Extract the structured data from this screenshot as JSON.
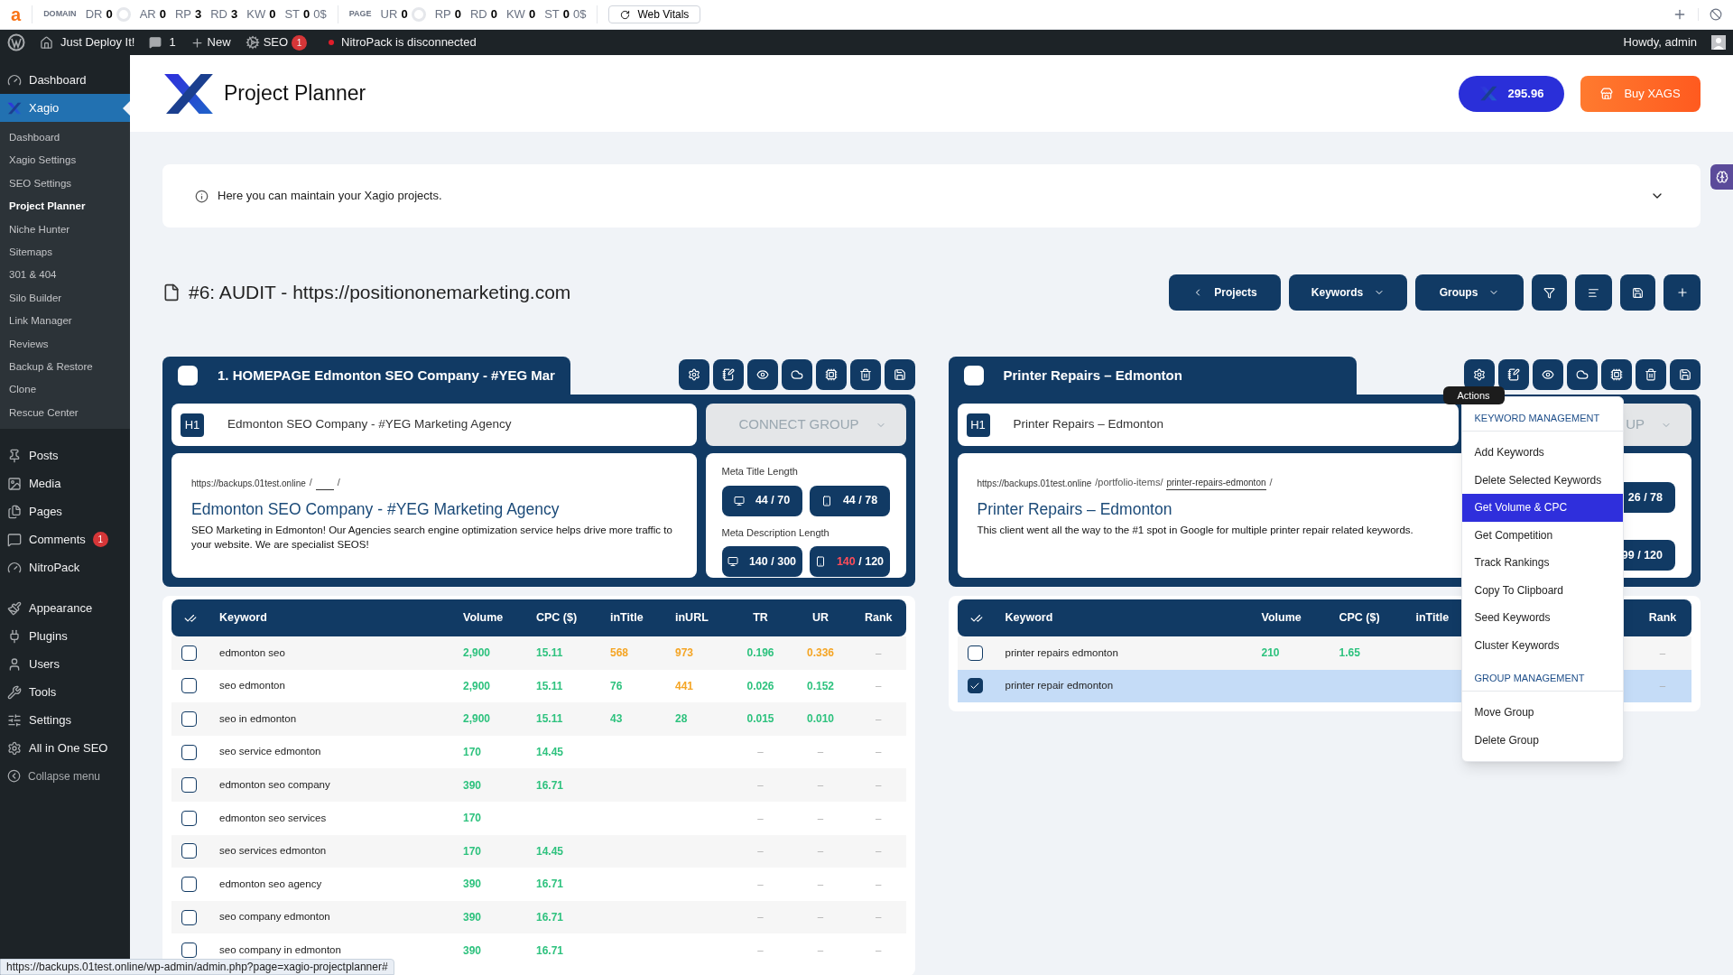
{
  "seo_toolbar": {
    "logo": "a",
    "groups": [
      {
        "label": "DOMAIN",
        "metrics": [
          {
            "name": "DR",
            "value": "0",
            "kind": "ring"
          },
          {
            "name": "AR",
            "value": "0",
            "kind": "plain"
          },
          {
            "name": "RP",
            "value": "3",
            "kind": "plain"
          },
          {
            "name": "RD",
            "value": "3",
            "kind": "plain"
          },
          {
            "name": "KW",
            "value": "0",
            "kind": "plain"
          },
          {
            "name": "ST",
            "value": "0",
            "kind": "plain",
            "extra": "0$"
          }
        ]
      },
      {
        "label": "PAGE",
        "metrics": [
          {
            "name": "UR",
            "value": "0",
            "kind": "ring"
          },
          {
            "name": "RP",
            "value": "0",
            "kind": "plain"
          },
          {
            "name": "RD",
            "value": "0",
            "kind": "plain"
          },
          {
            "name": "KW",
            "value": "0",
            "kind": "plain"
          },
          {
            "name": "ST",
            "value": "0",
            "kind": "plain",
            "extra": "0$"
          }
        ]
      }
    ],
    "button": "Web Vitals"
  },
  "admin_bar": {
    "site": "Just Deploy It!",
    "comments": "1",
    "new": "New",
    "seo": "SEO",
    "seo_badge": "1",
    "notice": "NitroPack is disconnected",
    "greeting": "Howdy, admin"
  },
  "sidebar": {
    "sections": [
      [
        {
          "label": "Dashboard",
          "selected": false
        },
        {
          "label": "Xagio",
          "selected": true,
          "children": [
            {
              "label": "Dashboard",
              "selected": false
            },
            {
              "label": "Xagio Settings",
              "selected": false
            },
            {
              "label": "SEO Settings",
              "selected": false
            },
            {
              "label": "Project Planner",
              "selected": true
            },
            {
              "label": "Niche Hunter",
              "selected": false
            },
            {
              "label": "Sitemaps",
              "selected": false
            },
            {
              "label": "301 & 404",
              "selected": false
            },
            {
              "label": "Silo Builder",
              "selected": false
            },
            {
              "label": "Link Manager",
              "selected": false
            },
            {
              "label": "Reviews",
              "selected": false
            },
            {
              "label": "Backup & Restore",
              "selected": false
            },
            {
              "label": "Clone",
              "selected": false
            },
            {
              "label": "Rescue Center",
              "selected": false
            }
          ]
        }
      ],
      [
        {
          "label": "Posts",
          "selected": false
        },
        {
          "label": "Media",
          "selected": false
        },
        {
          "label": "Pages",
          "selected": false
        },
        {
          "label": "Comments",
          "selected": false,
          "badge": "1"
        },
        {
          "label": "NitroPack",
          "selected": false
        }
      ],
      [
        {
          "label": "Appearance",
          "selected": false
        },
        {
          "label": "Plugins",
          "selected": false
        },
        {
          "label": "Users",
          "selected": false
        },
        {
          "label": "Tools",
          "selected": false
        },
        {
          "label": "Settings",
          "selected": false
        },
        {
          "label": "All in One SEO",
          "selected": false
        }
      ]
    ],
    "collapse": "Collapse menu"
  },
  "header": {
    "title": "Project Planner",
    "credits": "295.96",
    "buy": "Buy XAGS"
  },
  "info": "Here you can maintain your Xagio projects.",
  "project": {
    "title": "#6: AUDIT - https://positiononemarketing.com",
    "buttons": [
      "Projects",
      "Keywords",
      "Groups"
    ]
  },
  "groups": [
    {
      "selected": false,
      "name": "1. HOMEPAGE Edmonton SEO Company - #YEG Mar",
      "tag": "H1",
      "h1": "Edmonton SEO Company - #YEG Marketing Agency",
      "connect_group": "CONNECT GROUP",
      "serp": {
        "url": "https://backups.01test.online",
        "path": "/",
        "end": "/",
        "title": "Edmonton SEO Company - #YEG Marketing Agency",
        "description": "SEO Marketing in Edmonton! Our Agencies search engine optimization service helps drive more traffic to your website. We are specialist SEOS!"
      },
      "meta": [
        {
          "label": "Meta Title Length",
          "badges": [
            {
              "kind": "desktop",
              "count": "44",
              "limit": "/ 70",
              "over": false
            },
            {
              "kind": "mobile",
              "count": "44",
              "limit": "/ 78",
              "over": false
            }
          ]
        },
        {
          "label": "Meta Description Length",
          "badges": [
            {
              "kind": "desktop",
              "count": "140",
              "limit": "/ 300",
              "over": false
            },
            {
              "kind": "mobile",
              "count": "140",
              "limit": "/ 120",
              "over": true
            }
          ]
        }
      ],
      "table": {
        "columns": [
          "Keyword",
          "Volume",
          "CPC ($)",
          "inTitle",
          "inURL",
          "TR",
          "UR",
          "Rank"
        ],
        "rows": [
          {
            "selected": false,
            "cells": [
              "edmonton seo",
              {
                "value": "2,900",
                "color": "#2ec27e"
              },
              {
                "value": "15.11",
                "color": "#2ec27e"
              },
              {
                "value": "568",
                "color": "#f5a524"
              },
              {
                "value": "973",
                "color": "#f5a524"
              },
              {
                "value": "0.196",
                "color": "#2ec27e"
              },
              {
                "value": "0.336",
                "color": "#f5a524"
              },
              "–"
            ]
          },
          {
            "selected": false,
            "cells": [
              "seo edmonton",
              {
                "value": "2,900",
                "color": "#2ec27e"
              },
              {
                "value": "15.11",
                "color": "#2ec27e"
              },
              {
                "value": "76",
                "color": "#2ec27e"
              },
              {
                "value": "441",
                "color": "#f5a524"
              },
              {
                "value": "0.026",
                "color": "#2ec27e"
              },
              {
                "value": "0.152",
                "color": "#2ec27e"
              },
              "–"
            ]
          },
          {
            "selected": false,
            "cells": [
              "seo in edmonton",
              {
                "value": "2,900",
                "color": "#2ec27e"
              },
              {
                "value": "15.11",
                "color": "#2ec27e"
              },
              {
                "value": "43",
                "color": "#2ec27e"
              },
              {
                "value": "28",
                "color": "#2ec27e"
              },
              {
                "value": "0.015",
                "color": "#2ec27e"
              },
              {
                "value": "0.010",
                "color": "#2ec27e"
              },
              "–"
            ]
          },
          {
            "selected": false,
            "cells": [
              "seo service edmonton",
              {
                "value": "170",
                "color": "#2ec27e"
              },
              {
                "value": "14.45",
                "color": "#2ec27e"
              },
              null,
              null,
              "–",
              "–",
              "–"
            ]
          },
          {
            "selected": false,
            "cells": [
              "edmonton seo company",
              {
                "value": "390",
                "color": "#2ec27e"
              },
              {
                "value": "16.71",
                "color": "#2ec27e"
              },
              null,
              null,
              "–",
              "–",
              "–"
            ]
          },
          {
            "selected": false,
            "cells": [
              "edmonton seo services",
              {
                "value": "170",
                "color": "#2ec27e"
              },
              null,
              null,
              null,
              "–",
              "–",
              "–"
            ]
          },
          {
            "selected": false,
            "cells": [
              "seo services edmonton",
              {
                "value": "170",
                "color": "#2ec27e"
              },
              {
                "value": "14.45",
                "color": "#2ec27e"
              },
              null,
              null,
              "–",
              "–",
              "–"
            ]
          },
          {
            "selected": false,
            "cells": [
              "edmonton seo agency",
              {
                "value": "390",
                "color": "#2ec27e"
              },
              {
                "value": "16.71",
                "color": "#2ec27e"
              },
              null,
              null,
              "–",
              "–",
              "–"
            ]
          },
          {
            "selected": false,
            "cells": [
              "seo company edmonton",
              {
                "value": "390",
                "color": "#2ec27e"
              },
              {
                "value": "16.71",
                "color": "#2ec27e"
              },
              null,
              null,
              "–",
              "–",
              "–"
            ]
          },
          {
            "selected": false,
            "cells": [
              "seo company in edmonton",
              {
                "value": "390",
                "color": "#2ec27e"
              },
              {
                "value": "16.71",
                "color": "#2ec27e"
              },
              null,
              null,
              "–",
              "–",
              "–"
            ]
          }
        ]
      }
    },
    {
      "selected": false,
      "name": "Printer Repairs – Edmonton",
      "tag": "H1",
      "h1": "Printer Repairs – Edmonton",
      "connect_group": "UP",
      "serp": {
        "url": "https://backups.01test.online",
        "path": "/portfolio-items/",
        "slug": "printer-repairs-edmonton",
        "end": "/",
        "title": "Printer Repairs – Edmonton",
        "description": "This client went all the way to the #1 spot in Google for multiple printer repair related keywords."
      },
      "meta": [
        {
          "badges": [
            {
              "kind": "cut",
              "count": "26",
              "limit": "/ 78",
              "over": false
            }
          ]
        },
        {
          "badges": [
            {
              "kind": "cut",
              "count": "99",
              "limit": "/ 120",
              "over": false
            }
          ]
        }
      ],
      "table": {
        "columns": [
          "Keyword",
          "Volume",
          "CPC ($)",
          "inTitle",
          "Rank"
        ],
        "rows": [
          {
            "selected": false,
            "cells": [
              "printer repairs edmonton",
              {
                "value": "210",
                "color": "#2ec27e"
              },
              {
                "value": "1.65",
                "color": "#2ec27e"
              },
              null,
              "–"
            ]
          },
          {
            "selected": true,
            "cells": [
              "printer repair edmonton",
              null,
              null,
              null,
              "–"
            ]
          }
        ]
      }
    }
  ],
  "actions_menu": {
    "tooltip": "Actions",
    "items": [
      {
        "kind": "header",
        "label": "KEYWORD MANAGEMENT"
      },
      {
        "kind": "item",
        "label": "Add Keywords",
        "selected": false
      },
      {
        "kind": "item",
        "label": "Delete Selected Keywords",
        "selected": false
      },
      {
        "kind": "item",
        "label": "Get Volume & CPC",
        "selected": true
      },
      {
        "kind": "item",
        "label": "Get Competition",
        "selected": false
      },
      {
        "kind": "item",
        "label": "Track Rankings",
        "selected": false
      },
      {
        "kind": "item",
        "label": "Copy To Clipboard",
        "selected": false
      },
      {
        "kind": "item",
        "label": "Seed Keywords",
        "selected": false
      },
      {
        "kind": "item",
        "label": "Cluster Keywords",
        "selected": false
      },
      {
        "kind": "header",
        "label": "GROUP MANAGEMENT"
      },
      {
        "kind": "item",
        "label": "Move Group",
        "selected": false
      },
      {
        "kind": "item",
        "label": "Delete Group",
        "selected": false
      }
    ]
  },
  "status_bar": "https://backups.01test.online/wp-admin/admin.php?page=xagio-projectplanner#"
}
